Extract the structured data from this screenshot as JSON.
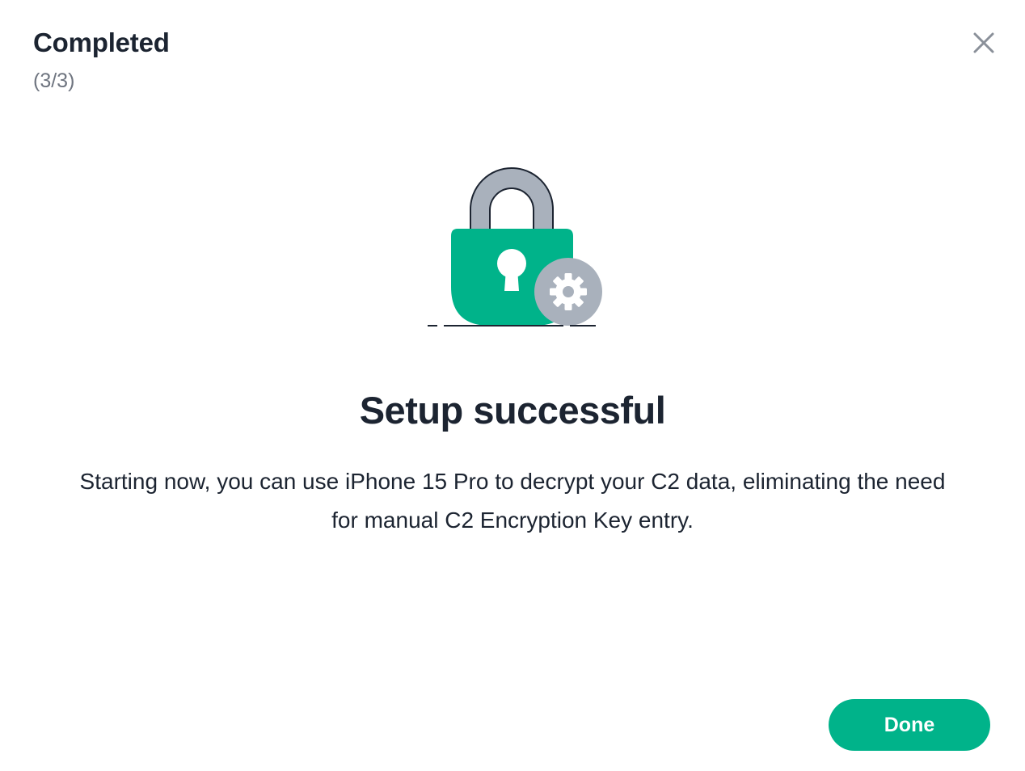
{
  "header": {
    "title": "Completed",
    "step": "(3/3)"
  },
  "icons": {
    "close": "close-icon",
    "lock": "padlock-icon",
    "gear": "gear-icon"
  },
  "colors": {
    "accent": "#00b38a",
    "lock_shackle": "#a9b1bc",
    "gear_badge": "#a9b1bc",
    "text_primary": "#1c2431",
    "text_secondary": "#6f7580"
  },
  "main": {
    "title": "Setup successful",
    "description": "Starting now, you can use iPhone 15 Pro to decrypt your C2 data, eliminating the need for manual C2 Encryption Key entry."
  },
  "footer": {
    "done_label": "Done"
  }
}
